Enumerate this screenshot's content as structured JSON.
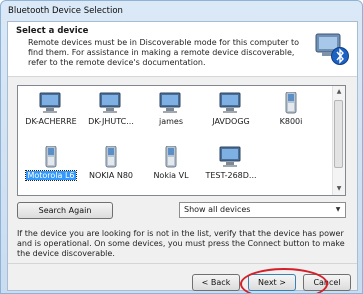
{
  "window": {
    "title": "Bluetooth Device Selection"
  },
  "header": {
    "title": "Select a device",
    "description": "Remote devices must be in Discoverable mode for this computer to find them. For assistance in making a remote device discoverable, refer to the remote device's documentation."
  },
  "devices": [
    {
      "label": "DK-ACHERRE",
      "icon": "computer-icon",
      "selected": false
    },
    {
      "label": "DK-JHUTC...",
      "icon": "computer-icon",
      "selected": false
    },
    {
      "label": "james",
      "icon": "computer-icon",
      "selected": false
    },
    {
      "label": "JAVDOGG",
      "icon": "computer-icon",
      "selected": false
    },
    {
      "label": "K800i",
      "icon": "phone-icon",
      "selected": false
    },
    {
      "label": "Motorola L6",
      "icon": "phone-icon",
      "selected": true
    },
    {
      "label": "NOKIA N80",
      "icon": "phone-icon",
      "selected": false
    },
    {
      "label": "Nokia VL",
      "icon": "phone-icon",
      "selected": false
    },
    {
      "label": "TEST-268D...",
      "icon": "computer-icon",
      "selected": false
    }
  ],
  "controls": {
    "search_again": "Search Again",
    "filter_selected": "Show all devices"
  },
  "info_text": "If the device you are looking for is not in the list, verify that the device has power and is operational. On some devices, you must press the Connect button to make the device discoverable.",
  "buttons": {
    "back": "< Back",
    "next": "Next >",
    "cancel": "Cancel"
  },
  "colors": {
    "selection": "#3399ff",
    "highlight_ring": "#d4202a",
    "title_bar": "#c9dcf0"
  }
}
